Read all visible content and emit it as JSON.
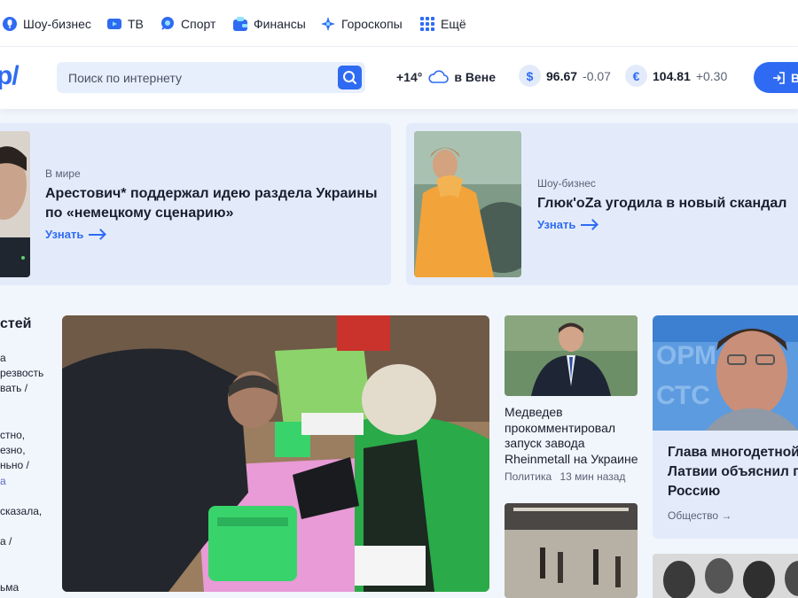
{
  "nav": {
    "items": [
      {
        "label": "Шоу-бизнес",
        "icon": "microphone-icon"
      },
      {
        "label": "ТВ",
        "icon": "tv-icon"
      },
      {
        "label": "Спорт",
        "icon": "ball-icon"
      },
      {
        "label": "Финансы",
        "icon": "wallet-icon"
      },
      {
        "label": "Гороскопы",
        "icon": "star-icon"
      },
      {
        "label": "Ещё",
        "icon": "grid-icon"
      }
    ]
  },
  "header": {
    "logo_text": "p/",
    "search_placeholder": "Поиск по интернету",
    "weather": {
      "temp": "+14°",
      "city": "в Вене",
      "icon": "cloud-icon"
    },
    "rates": [
      {
        "symbol": "$",
        "value": "96.67",
        "change": "-0.07"
      },
      {
        "symbol": "€",
        "value": "104.81",
        "change": "+0.30"
      }
    ],
    "login_label": "Во"
  },
  "promos": [
    {
      "category": "В мире",
      "title": "Арестович* поддержал идею раздела Украины по «немецкому сценарию»",
      "link": "Узнать"
    },
    {
      "category": "Шоу-бизнес",
      "title": "Глюк'oZa угодила в новый скандал",
      "link": "Узнать"
    }
  ],
  "left_column": {
    "heading": "стей",
    "lines": [
      "а",
      "резвость",
      "вать /",
      "",
      "стно,",
      "езно,",
      "ньно /",
      "а",
      "",
      "сказала,",
      "",
      "а /",
      "",
      "ьма"
    ]
  },
  "news": [
    {
      "title": "Медведев прокомментировал запуск завода Rheinmetall на Украине",
      "category": "Политика",
      "time": "13 мин назад"
    }
  ],
  "right_card": {
    "title": "Глава многодетной Латвии объяснил п Россию",
    "category": "Общество →"
  },
  "colors": {
    "accent": "#2f6bf2",
    "card_bg": "#e3ebfb",
    "page_bg": "#f1f5fc"
  }
}
